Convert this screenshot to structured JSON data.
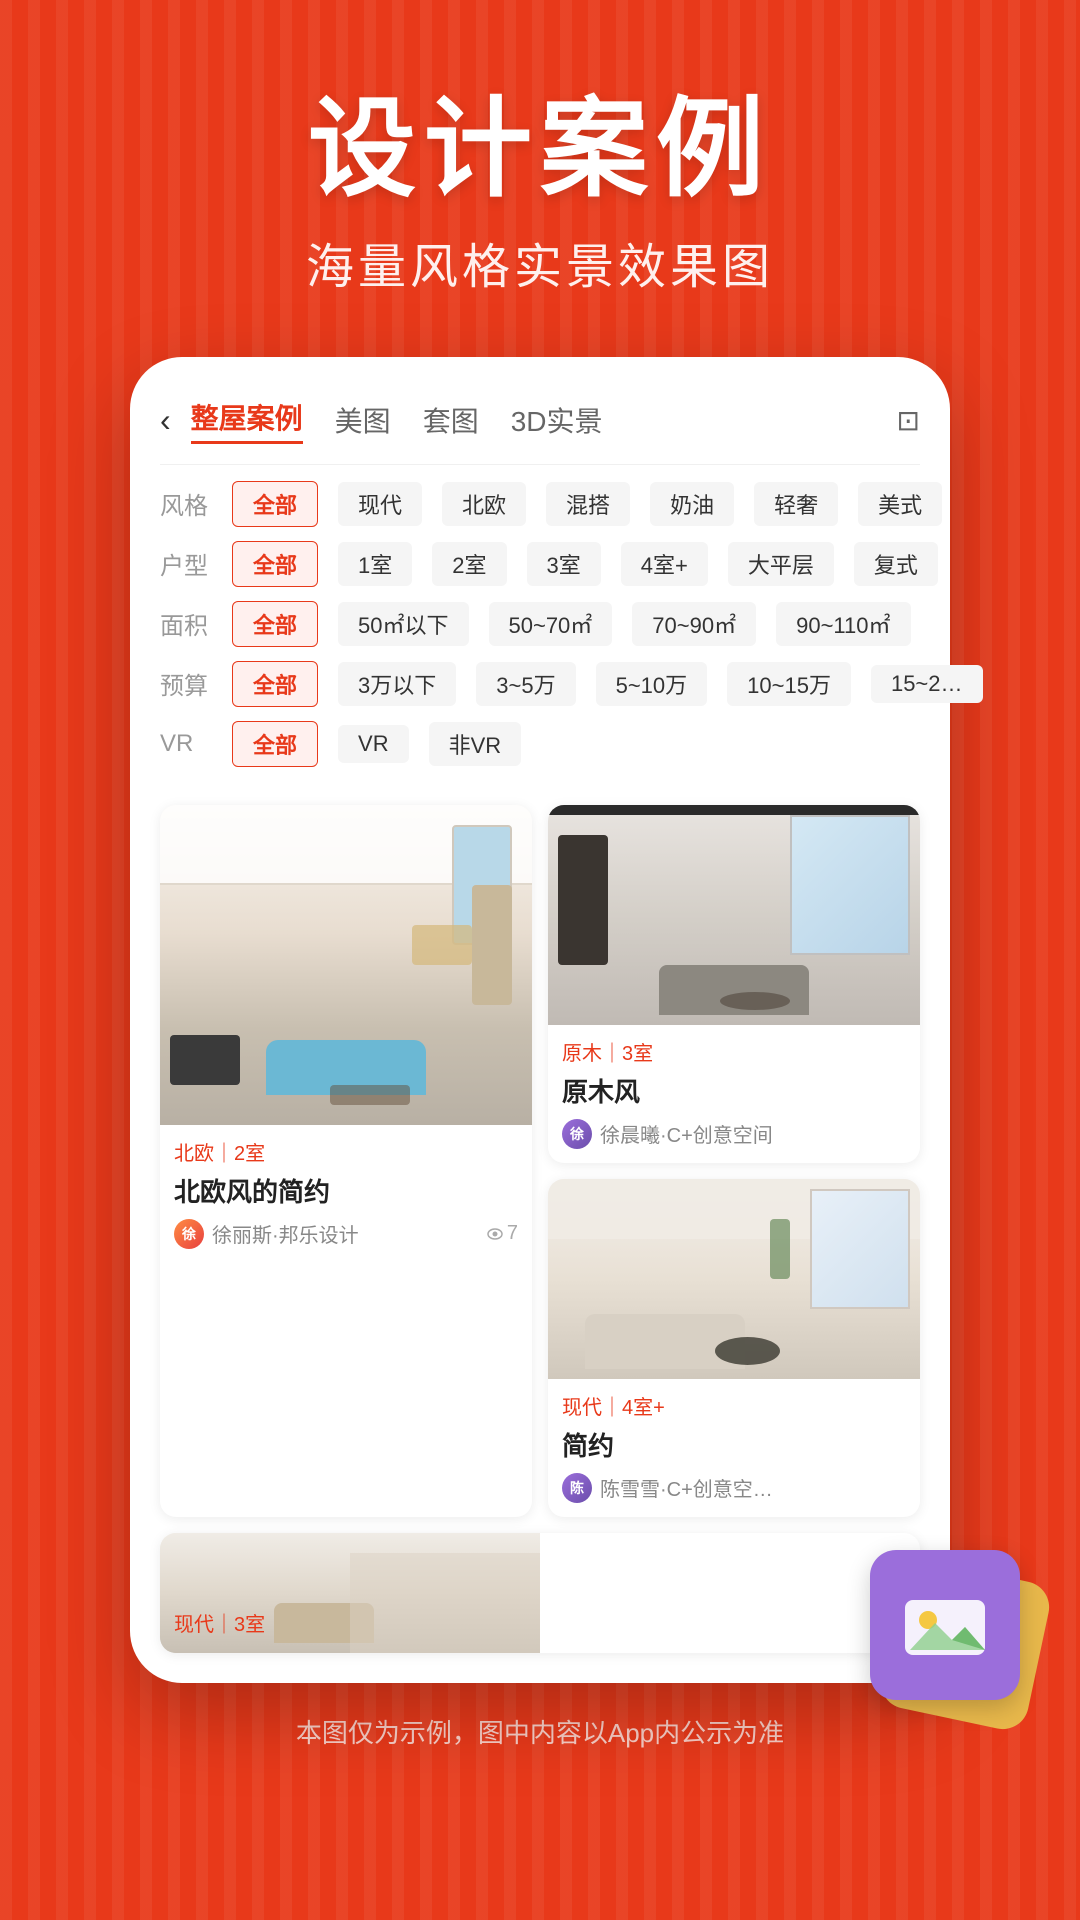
{
  "page": {
    "background_color": "#E8391A",
    "header": {
      "main_title": "设计案例",
      "sub_title": "海量风格实景效果图"
    },
    "footer_note": "本图仅为示例，图中内容以App内公示为准"
  },
  "nav": {
    "back_icon": "‹",
    "tabs": [
      {
        "label": "整屋案例",
        "active": true
      },
      {
        "label": "美图",
        "active": false
      },
      {
        "label": "套图",
        "active": false
      },
      {
        "label": "3D实景",
        "active": false
      }
    ],
    "bookmark_icon": "⊡"
  },
  "filters": [
    {
      "label": "风格",
      "options": [
        {
          "text": "全部",
          "active": true
        },
        {
          "text": "现代",
          "active": false
        },
        {
          "text": "北欧",
          "active": false
        },
        {
          "text": "混搭",
          "active": false
        },
        {
          "text": "奶油",
          "active": false
        },
        {
          "text": "轻奢",
          "active": false
        },
        {
          "text": "美式",
          "active": false
        }
      ]
    },
    {
      "label": "户型",
      "options": [
        {
          "text": "全部",
          "active": true
        },
        {
          "text": "1室",
          "active": false
        },
        {
          "text": "2室",
          "active": false
        },
        {
          "text": "3室",
          "active": false
        },
        {
          "text": "4室+",
          "active": false
        },
        {
          "text": "大平层",
          "active": false
        },
        {
          "text": "复式",
          "active": false
        }
      ]
    },
    {
      "label": "面积",
      "options": [
        {
          "text": "全部",
          "active": true
        },
        {
          "text": "50㎡以下",
          "active": false
        },
        {
          "text": "50~70㎡",
          "active": false
        },
        {
          "text": "70~90㎡",
          "active": false
        },
        {
          "text": "90~110㎡",
          "active": false
        }
      ]
    },
    {
      "label": "预算",
      "options": [
        {
          "text": "全部",
          "active": true
        },
        {
          "text": "3万以下",
          "active": false
        },
        {
          "text": "3~5万",
          "active": false
        },
        {
          "text": "5~10万",
          "active": false
        },
        {
          "text": "10~15万",
          "active": false
        },
        {
          "text": "15~2…",
          "active": false
        }
      ]
    },
    {
      "label": "VR",
      "options": [
        {
          "text": "全部",
          "active": true
        },
        {
          "text": "VR",
          "active": false
        },
        {
          "text": "非VR",
          "active": false
        }
      ]
    }
  ],
  "cards": [
    {
      "id": "card-1",
      "style_tag": "北欧｜2室",
      "title": "北欧风的简约",
      "designer": "徐丽斯·邦乐设计",
      "view_count": "7",
      "position": "left-top",
      "size": "large"
    },
    {
      "id": "card-2",
      "style_tag": "原木｜3室",
      "title": "原木风",
      "designer": "徐晨曦·C+创意空间",
      "view_count": "",
      "position": "right-top",
      "size": "normal"
    },
    {
      "id": "card-3",
      "style_tag": "现代｜3室",
      "title": "",
      "designer": "",
      "view_count": "",
      "position": "left-bottom",
      "size": "partial"
    },
    {
      "id": "card-4",
      "style_tag": "现代｜4室+",
      "title": "简约",
      "designer": "陈雪雪·C+创意空…",
      "view_count": "",
      "position": "right-bottom",
      "size": "normal"
    }
  ],
  "decoration": {
    "photo_icon_color": "#9B6EDB",
    "photo_icon_bg_color": "#E8B84B"
  },
  "accent_color": "#E8391A"
}
